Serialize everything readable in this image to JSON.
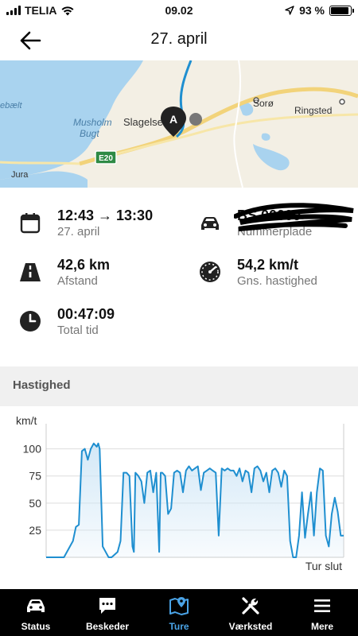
{
  "status_bar": {
    "carrier": "TELIA",
    "time": "09.02",
    "battery": "93 %",
    "battery_level": 0.93
  },
  "header": {
    "title": "27. april"
  },
  "map": {
    "places": [
      "Slagelse",
      "Sorø",
      "Ringsted",
      "Musholm",
      "Bugt",
      "ebælt",
      "Jura"
    ],
    "road_label": "E20",
    "marker_label": "A"
  },
  "trip": {
    "time_range": "12:43 → 13:30",
    "date": "27. april",
    "plate_value": "BS 00000",
    "plate_label": "Nummerplade",
    "distance": "42,6 km",
    "distance_label": "Afstand",
    "avg_speed": "54,2 km/t",
    "avg_speed_label": "Gns. hastighed",
    "total_time": "00:47:09",
    "total_time_label": "Total tid"
  },
  "section": {
    "speed_title": "Hastighed"
  },
  "chart_data": {
    "type": "area",
    "ylabel": "km/t",
    "xlabel": "",
    "end_label": "Tur slut",
    "ylim": [
      0,
      110
    ],
    "y_ticks": [
      "100",
      "75",
      "50",
      "25"
    ],
    "y_tick_values": [
      100,
      75,
      50,
      25
    ],
    "x": [
      0,
      6,
      8,
      9,
      10,
      11,
      12,
      13,
      14,
      15,
      16,
      17,
      17.5,
      18,
      19,
      20,
      21,
      22,
      24,
      25,
      26,
      27,
      28,
      29,
      29.5,
      30,
      31,
      32,
      33,
      34,
      35,
      36,
      37,
      38,
      38.5,
      39,
      40,
      41,
      42,
      43,
      44,
      45,
      46,
      47,
      48,
      49,
      50,
      51,
      52,
      53,
      54,
      55,
      56,
      57,
      58,
      59,
      60,
      61,
      62,
      63,
      64,
      65,
      66,
      67,
      68,
      69,
      70,
      71,
      72,
      73,
      74,
      75,
      76,
      77,
      78,
      79,
      80,
      81,
      82,
      83,
      84,
      85,
      86,
      87,
      88,
      89,
      90,
      91,
      92,
      93,
      94,
      95,
      96,
      97,
      98,
      99,
      100
    ],
    "values": [
      0,
      0,
      10,
      15,
      28,
      30,
      98,
      100,
      90,
      100,
      105,
      102,
      105,
      100,
      10,
      5,
      0,
      0,
      5,
      15,
      78,
      78,
      75,
      10,
      5,
      78,
      75,
      70,
      50,
      78,
      80,
      60,
      78,
      5,
      78,
      78,
      75,
      40,
      45,
      78,
      80,
      78,
      60,
      80,
      84,
      80,
      82,
      84,
      62,
      78,
      80,
      82,
      80,
      78,
      20,
      82,
      80,
      82,
      80,
      80,
      75,
      82,
      70,
      80,
      78,
      60,
      82,
      84,
      80,
      70,
      78,
      60,
      80,
      82,
      78,
      65,
      80,
      75,
      15,
      0,
      0,
      20,
      60,
      18,
      40,
      60,
      20,
      60,
      82,
      80,
      20,
      10,
      40,
      55,
      42,
      20,
      20,
      0,
      0
    ],
    "color": "#1f8fd0",
    "fill": "#cfe6f6"
  },
  "tabs": [
    {
      "label": "Status",
      "icon": "car-icon"
    },
    {
      "label": "Beskeder",
      "icon": "chat-icon"
    },
    {
      "label": "Ture",
      "icon": "map-pin-icon"
    },
    {
      "label": "Værksted",
      "icon": "wrench-icon"
    },
    {
      "label": "Mere",
      "icon": "menu-icon"
    }
  ],
  "colors": {
    "accent": "#4aa3e6",
    "route": "#1f8fd0",
    "tabbar": "#000000"
  }
}
